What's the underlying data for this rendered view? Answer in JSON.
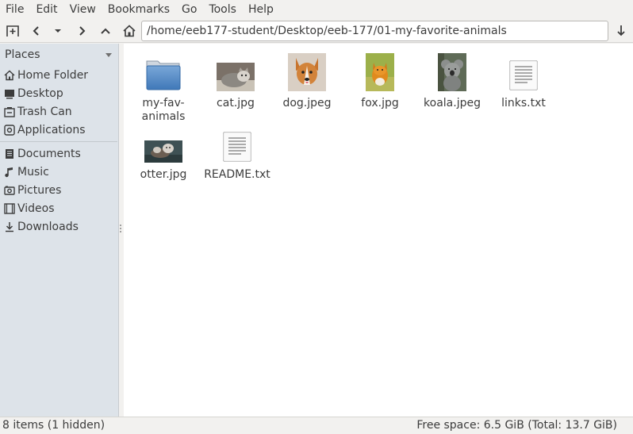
{
  "menu": [
    "File",
    "Edit",
    "View",
    "Bookmarks",
    "Go",
    "Tools",
    "Help"
  ],
  "location": {
    "path": "/home/eeb177-student/Desktop/eeb-177/01-my-favorite-animals"
  },
  "toolbar_icons": [
    "new-tab-icon",
    "back-icon",
    "history-dropdown-icon",
    "forward-icon",
    "up-icon",
    "home-icon",
    "go-icon"
  ],
  "sidebar": {
    "header": "Places",
    "items": [
      {
        "label": "Home Folder",
        "icon": "home-folder-icon"
      },
      {
        "label": "Desktop",
        "icon": "desktop-icon"
      },
      {
        "label": "Trash Can",
        "icon": "trash-icon"
      },
      {
        "label": "Applications",
        "icon": "applications-icon"
      },
      {
        "label": "Documents",
        "icon": "documents-icon"
      },
      {
        "label": "Music",
        "icon": "music-icon"
      },
      {
        "label": "Pictures",
        "icon": "pictures-icon"
      },
      {
        "label": "Videos",
        "icon": "videos-icon"
      },
      {
        "label": "Downloads",
        "icon": "downloads-icon"
      }
    ]
  },
  "files": [
    {
      "label": "my-fav-animals",
      "line1": "my-fav-",
      "line2": "animals",
      "type": "folder"
    },
    {
      "label": "cat.jpg",
      "type": "image"
    },
    {
      "label": "dog.jpeg",
      "type": "image"
    },
    {
      "label": "fox.jpg",
      "type": "image"
    },
    {
      "label": "koala.jpeg",
      "type": "image"
    },
    {
      "label": "links.txt",
      "type": "text"
    },
    {
      "label": "otter.jpg",
      "type": "image"
    },
    {
      "label": "README.txt",
      "type": "text"
    }
  ],
  "status": {
    "items": "8 items (1 hidden)",
    "free_space": "Free space: 6.5 GiB (Total: 13.7 GiB)"
  },
  "colors": {
    "sidebar_bg": "#dde3e9",
    "folder_blue": "#5b8fc9",
    "content_bg": "#ffffff"
  }
}
